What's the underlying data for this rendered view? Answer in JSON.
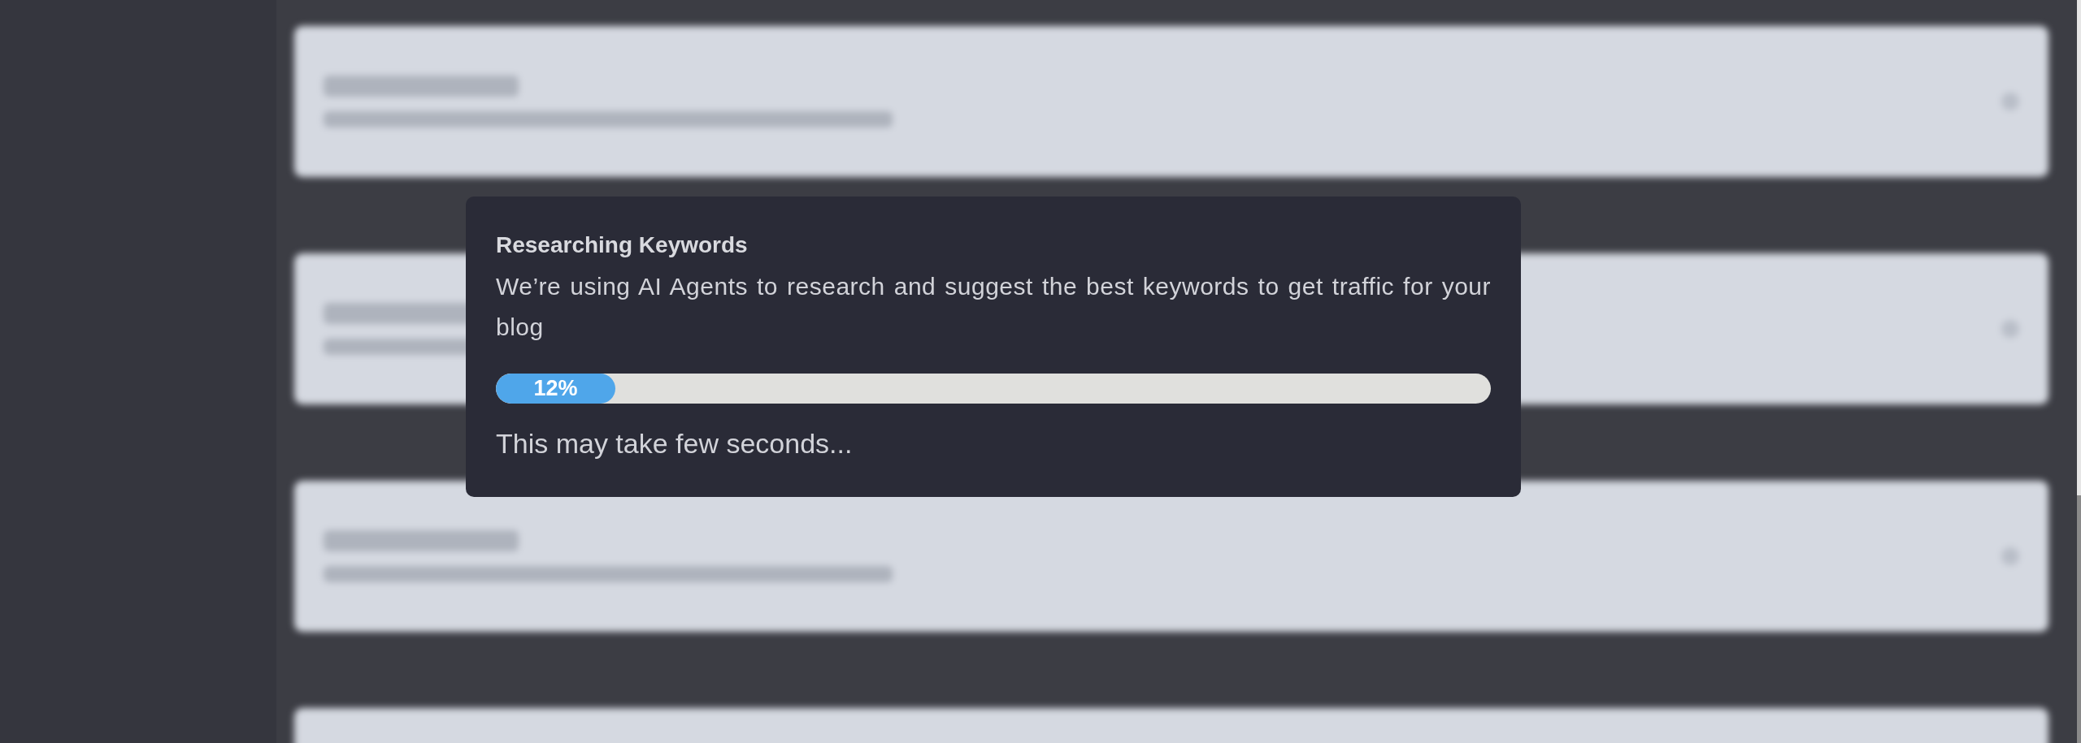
{
  "background_cards": [
    {
      "kind": "card"
    },
    {
      "kind": "card"
    },
    {
      "kind": "card"
    },
    {
      "kind": "card"
    }
  ],
  "dialog": {
    "title": "Researching Keywords",
    "description": "We’re using AI Agents to research and suggest the best keywords to get traffic for your blog",
    "progress": {
      "level": 0.12,
      "reading": "12%"
    },
    "footer": "This may take few seconds..."
  }
}
